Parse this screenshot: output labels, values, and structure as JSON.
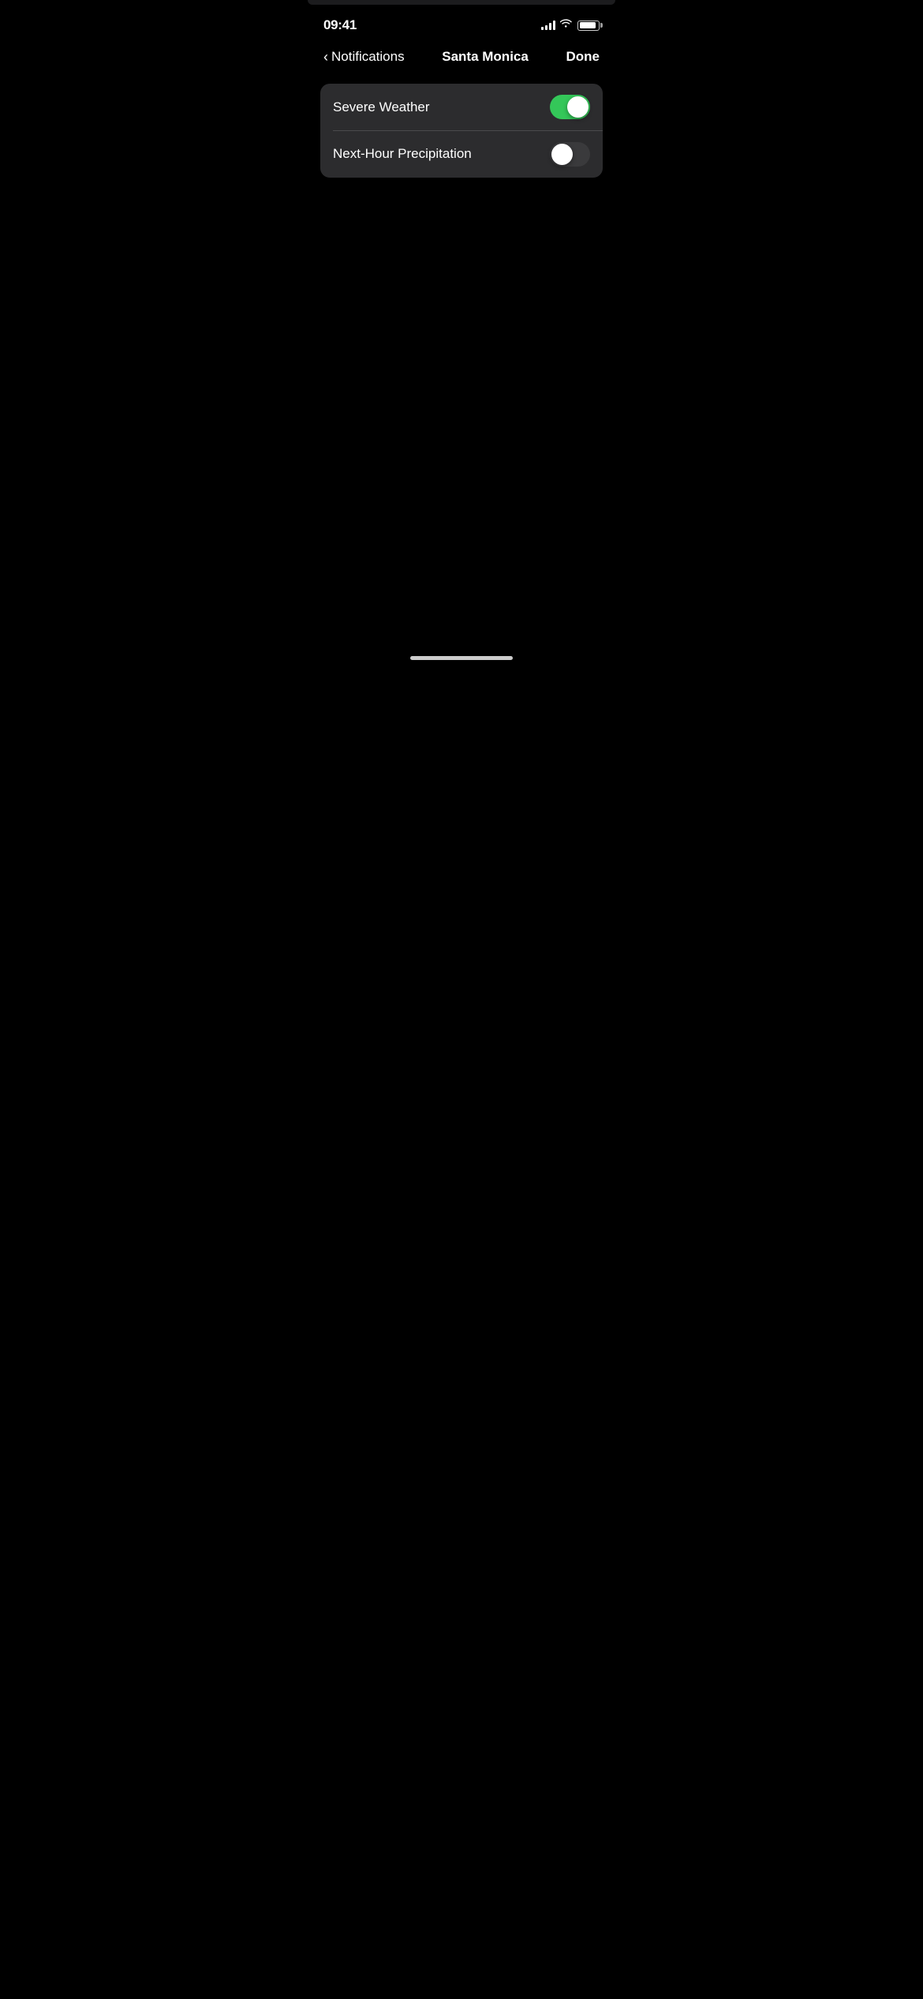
{
  "statusBar": {
    "time": "09:41",
    "signalBars": 4,
    "wifi": true,
    "battery": 90
  },
  "navigation": {
    "backLabel": "Notifications",
    "title": "Santa Monica",
    "doneLabel": "Done"
  },
  "settings": {
    "rows": [
      {
        "id": "severe-weather",
        "label": "Severe Weather",
        "enabled": true
      },
      {
        "id": "next-hour-precipitation",
        "label": "Next-Hour Precipitation",
        "enabled": false
      }
    ]
  },
  "homeIndicator": true
}
